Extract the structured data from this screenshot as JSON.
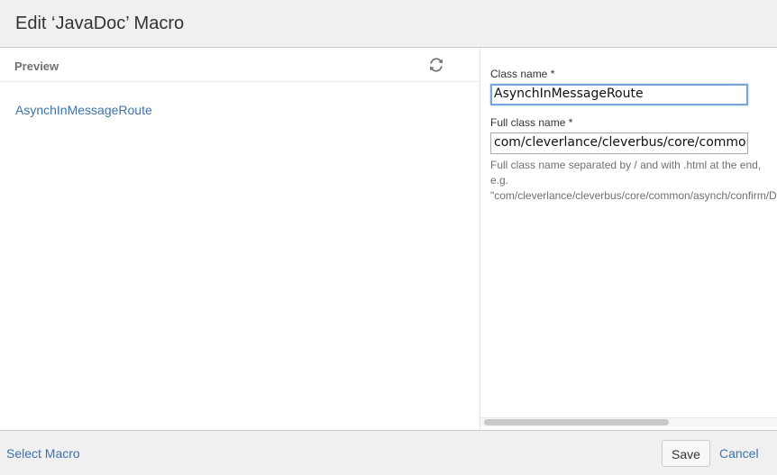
{
  "header": {
    "title": "Edit ‘JavaDoc’ Macro"
  },
  "preview": {
    "label": "Preview",
    "refresh_icon": "refresh-icon",
    "link_text": "AsynchInMessageRoute"
  },
  "form": {
    "class_name": {
      "label": "Class name *",
      "value": "AsynchInMessageRoute"
    },
    "full_class_name": {
      "label": "Full class name *",
      "value": "com/cleverlance/cleverbus/core/common/asynch/confirm/DefaultConfirmationPollExecutor.html"
    },
    "help_lines": [
      "Full class name separated by / and with .html at the end,",
      "e.g.",
      "\"com/cleverlance/cleverbus/core/common/asynch/confirm/D"
    ],
    "scroll_position": 0
  },
  "footer": {
    "select_macro": "Select Macro",
    "save_label": "Save",
    "cancel_label": "Cancel"
  },
  "colors": {
    "link": "#3b73af",
    "header_bg": "#f0f0f0",
    "focus_border": "#7aa7db"
  }
}
